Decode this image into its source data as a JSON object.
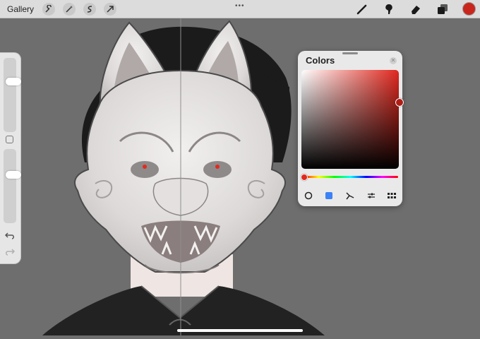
{
  "topbar": {
    "gallery_label": "Gallery",
    "left_tools": [
      "wrench-icon",
      "magic-wand-icon",
      "selection-icon",
      "transform-arrow-icon"
    ],
    "right_tools": [
      "brush-icon",
      "smudge-icon",
      "eraser-icon",
      "layers-icon"
    ],
    "current_color": "#c8261d"
  },
  "sidebar": {
    "brush_size_level": 0.3,
    "opacity_level": 0.33
  },
  "colors_panel": {
    "title": "Colors",
    "current_color": "#b01d15",
    "hue_color": "#e0281e",
    "tabs": [
      "disc-icon",
      "classic-square-icon",
      "harmony-icon",
      "value-sliders-icon",
      "palettes-icon"
    ],
    "active_tab": "classic-square-icon"
  }
}
